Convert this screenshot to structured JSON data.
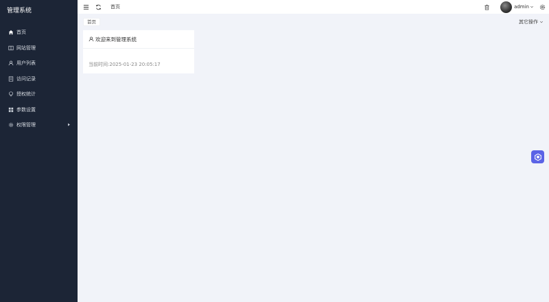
{
  "sidebar": {
    "brand": "管理系统",
    "items": [
      {
        "label": "首页",
        "icon": "home-icon"
      },
      {
        "label": "网站管理",
        "icon": "book-icon"
      },
      {
        "label": "用户列表",
        "icon": "user-icon"
      },
      {
        "label": "访问记录",
        "icon": "document-icon"
      },
      {
        "label": "授权统计",
        "icon": "lightbulb-icon"
      },
      {
        "label": "参数设置",
        "icon": "grid-icon"
      },
      {
        "label": "权限管理",
        "icon": "gear-icon",
        "has_submenu": true
      }
    ]
  },
  "header": {
    "breadcrumb": "首页",
    "user": "admin"
  },
  "tabs": {
    "home": "首页",
    "other_ops": "其它操作"
  },
  "card": {
    "title": "欢迎来到管理系统",
    "time_label": "当前时间:",
    "time_value": "2025-01-23 20:05:17"
  },
  "colors": {
    "sidebar_bg": "#1c2536",
    "page_bg": "#f1f3f9",
    "float_button": "#5b63e6"
  }
}
